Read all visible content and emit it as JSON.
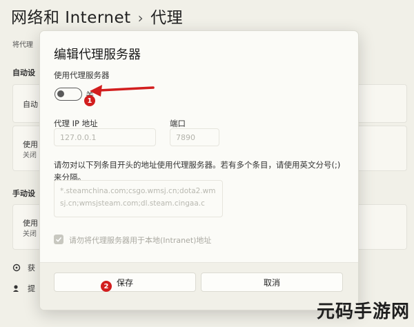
{
  "page": {
    "title_part1": "网络和 Internet",
    "title_sep": "›",
    "title_part2": "代理",
    "desc": "将代理",
    "auto_section": "自动设",
    "auto_card1_title": "自动",
    "auto_card2_title": "使用",
    "auto_card2_sub": "关闭",
    "manual_section": "手动设",
    "manual_card_title": "使用",
    "manual_card_sub": "关闭",
    "link1": "获",
    "link2": "提"
  },
  "dialog": {
    "title": "编辑代理服务器",
    "use_proxy_label": "使用代理服务器",
    "toggle_state": "关",
    "toggle_on": false,
    "ip_label": "代理 IP 地址",
    "ip_placeholder": "127.0.0.1",
    "port_label": "端口",
    "port_placeholder": "7890",
    "exceptions_desc": "请勿对以下列条目开头的地址使用代理服务器。若有多个条目，请使用英文分号(;) 来分隔。",
    "exceptions_value": "*.steamchina.com;csgo.wmsj.cn;dota2.wmsj.cn;wmsjsteam.com;dl.steam.cingaa.c",
    "local_checkbox_label": "请勿将代理服务器用于本地(Intranet)地址",
    "local_checked": true,
    "save_label": "保存",
    "cancel_label": "取消"
  },
  "annotations": {
    "badge1": "1",
    "badge2": "2",
    "badge_color": "#d21e1e"
  },
  "watermark": "元码手游网",
  "icons": [
    "checkmark-icon",
    "arrow-annotation-icon",
    "gift-icon",
    "feedback-icon"
  ]
}
